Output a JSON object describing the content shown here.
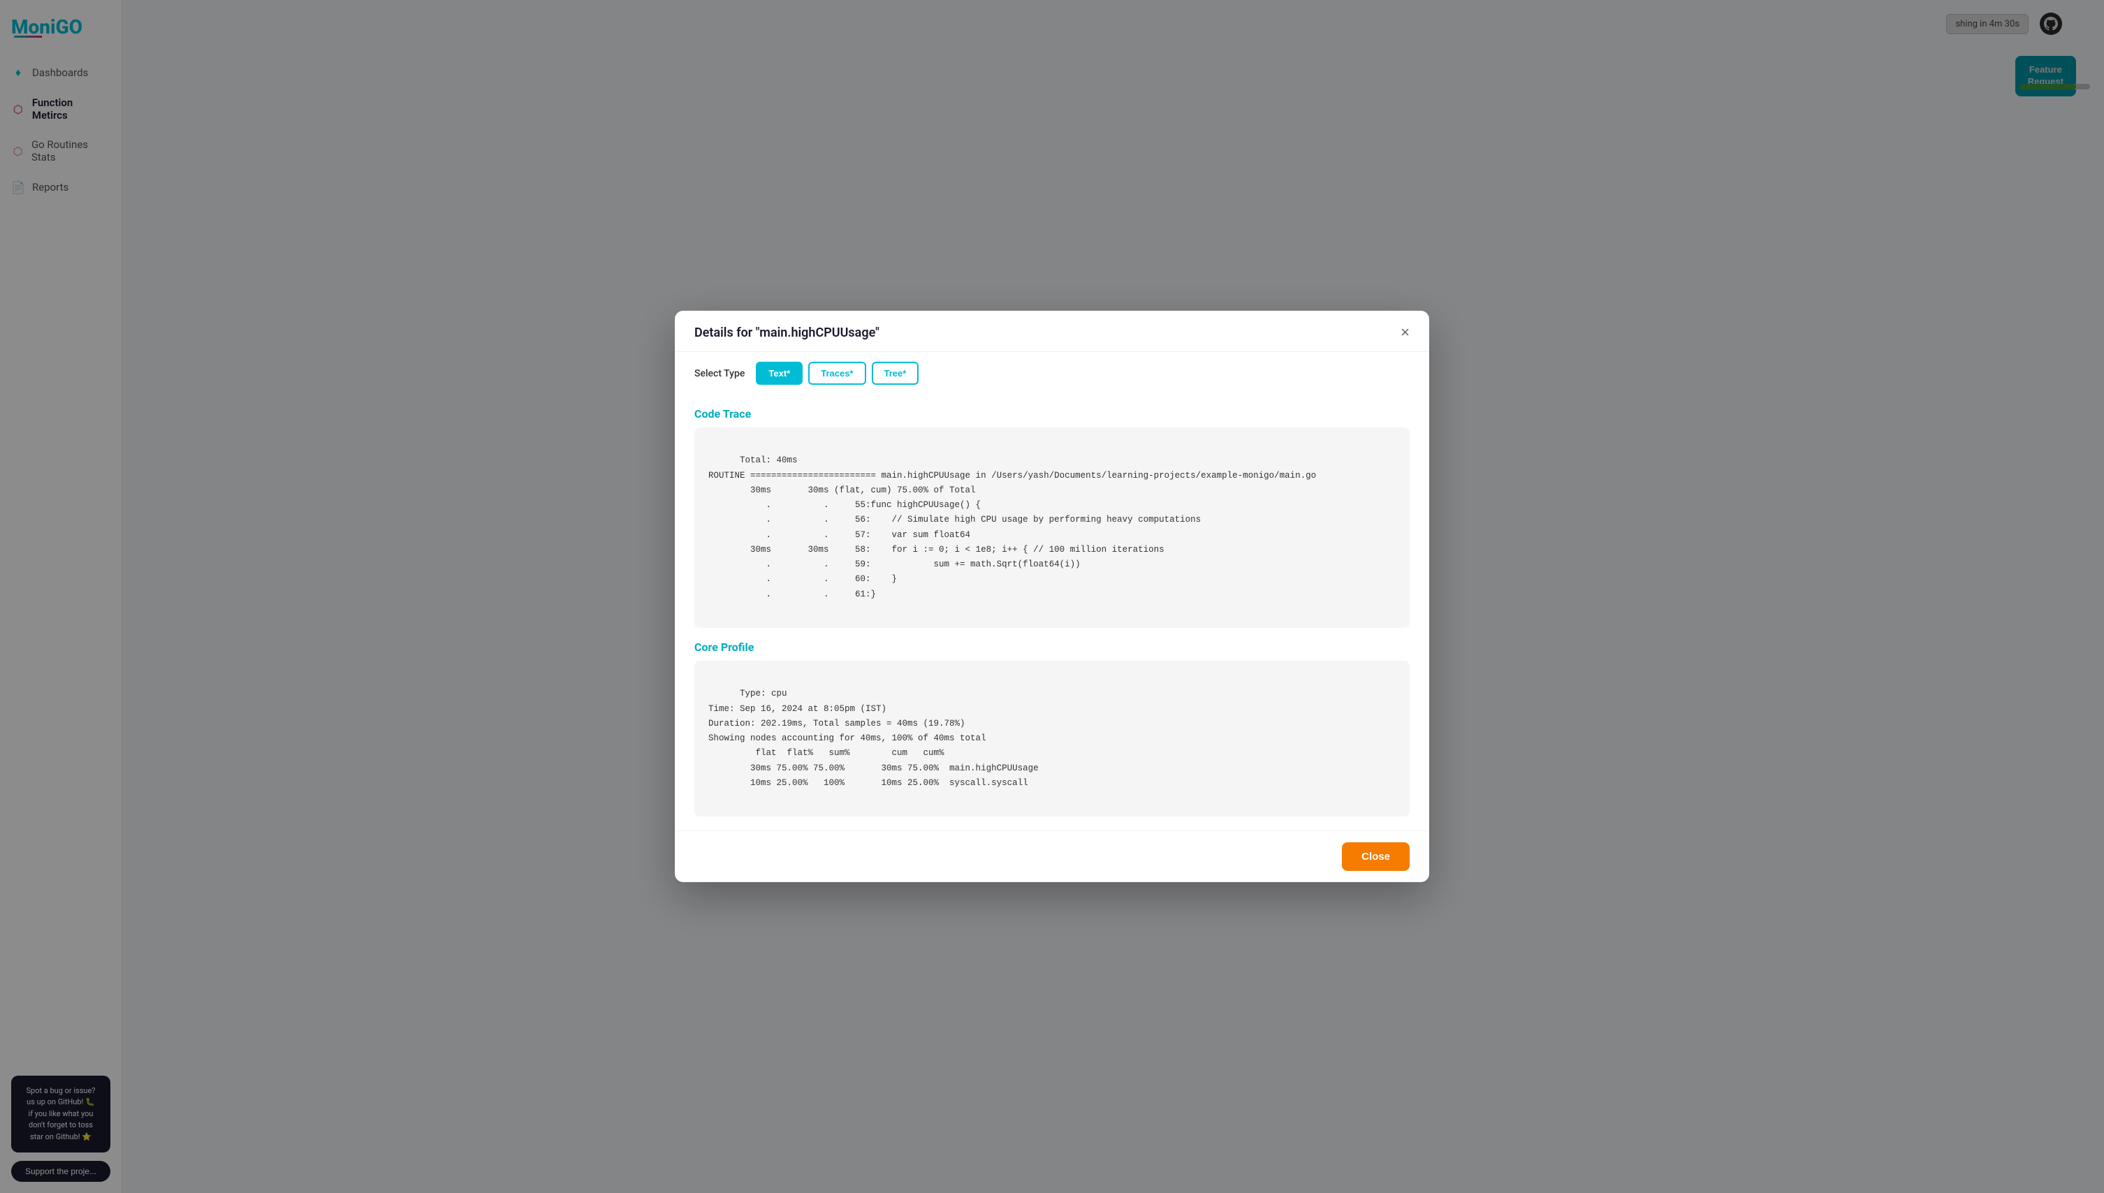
{
  "app": {
    "name": "MoniGO",
    "name_part1": "Moni",
    "name_part2": "GO"
  },
  "sidebar": {
    "items": [
      {
        "id": "dashboards",
        "label": "Dashboards",
        "icon": "♦",
        "iconType": "red"
      },
      {
        "id": "function-metrics",
        "label": "Function Metircs",
        "icon": "⬡",
        "iconType": "red"
      },
      {
        "id": "go-routines",
        "label": "Go Routines Stats",
        "icon": "⬡",
        "iconType": "red"
      },
      {
        "id": "reports",
        "label": "Reports",
        "icon": "📄",
        "iconType": "doc"
      }
    ],
    "bug_card": {
      "line1": "Spot a bug or issue?",
      "line2": "us up on GitHub! 🐛",
      "line3": "if you like what you",
      "line4": "don't forget to toss",
      "line5": "star on Github! ⭐"
    },
    "support_button": "Support the proje..."
  },
  "topbar": {
    "refresh_text": "shing in 4m 30s"
  },
  "feature_request": {
    "label": "Feature\nRequest"
  },
  "modal": {
    "title": "Details for \"main.highCPUUsage\"",
    "close_label": "×",
    "select_type_label": "Select Type",
    "tabs": [
      {
        "id": "text",
        "label": "Text*",
        "active": true
      },
      {
        "id": "traces",
        "label": "Traces*",
        "active": false
      },
      {
        "id": "tree",
        "label": "Tree*",
        "active": false
      }
    ],
    "code_trace_title": "Code Trace",
    "code_trace_content": "Total: 40ms\nROUTINE ======================== main.highCPUUsage in /Users/yash/Documents/learning-projects/example-monigo/main.go\n        30ms       30ms (flat, cum) 75.00% of Total\n           .          .     55:func highCPUUsage() {\n           .          .     56:    // Simulate high CPU usage by performing heavy computations\n           .          .     57:    var sum float64\n        30ms       30ms     58:    for i := 0; i < 1e8; i++ { // 100 million iterations\n           .          .     59:            sum += math.Sqrt(float64(i))\n           .          .     60:    }\n           .          .     61:}",
    "core_profile_title": "Core Profile",
    "core_profile_content": "Type: cpu\nTime: Sep 16, 2024 at 8:05pm (IST)\nDuration: 202.19ms, Total samples = 40ms (19.78%)\nShowing nodes accounting for 40ms, 100% of 40ms total\n         flat  flat%   sum%        cum   cum%\n        30ms 75.00% 75.00%       30ms 75.00%  main.highCPUUsage\n        10ms 25.00%   100%       10ms 25.00%  syscall.syscall",
    "close_button_label": "Close"
  }
}
